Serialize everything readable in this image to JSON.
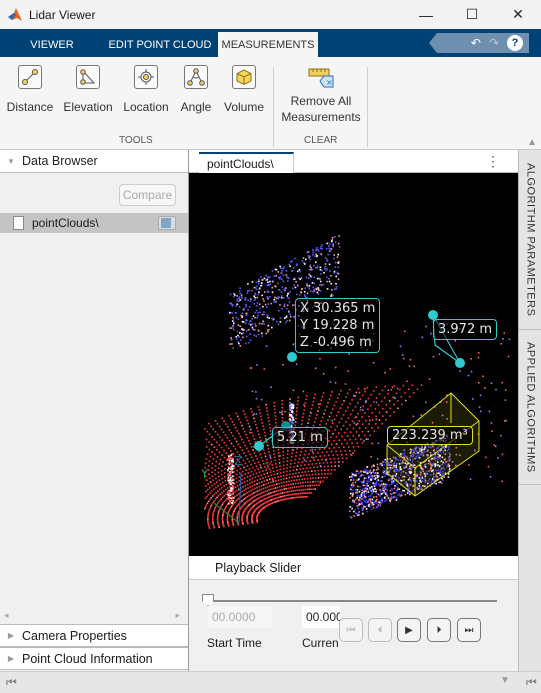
{
  "window": {
    "title": "Lidar Viewer",
    "minimize": "—",
    "maximize": "☐",
    "close": "✕"
  },
  "tabs": [
    {
      "label": "VIEWER",
      "active": false
    },
    {
      "label": "EDIT POINT CLOUD",
      "active": false
    },
    {
      "label": "MEASUREMENTS",
      "active": true
    }
  ],
  "quick_access": {
    "undo": "↶",
    "redo": "↷",
    "help": "?"
  },
  "ribbon": {
    "tools": [
      {
        "label": "Distance",
        "icon": "distance-icon"
      },
      {
        "label": "Elevation",
        "icon": "elevation-icon"
      },
      {
        "label": "Location",
        "icon": "location-icon"
      },
      {
        "label": "Angle",
        "icon": "angle-icon"
      },
      {
        "label": "Volume",
        "icon": "volume-icon"
      }
    ],
    "tools_group": "TOOLS",
    "remove_all": {
      "line1": "Remove All",
      "line2": "Measurements"
    },
    "clear_group": "CLEAR"
  },
  "data_browser": {
    "title": "Data Browser",
    "compare_label": "Compare",
    "items": [
      {
        "name": "pointClouds\\",
        "color": "#7fa7c9"
      }
    ]
  },
  "bottom_sections": [
    "Camera Properties",
    "Point Cloud Information"
  ],
  "document": {
    "tab_label": "pointClouds\\",
    "menu": "⋮"
  },
  "right_rail": [
    "ALGORITHM PARAMETERS",
    "APPLIED ALGORITHMS"
  ],
  "measurements": {
    "location": {
      "x": "X 30.365 m",
      "y": "Y 19.228 m",
      "z": "Z -0.496 m"
    },
    "distance_1": "3.972 m",
    "distance_2": "5.21 m",
    "volume": "223.239 m³",
    "colors": {
      "callout": "#2fc9cf",
      "volume": "#e6e21a"
    }
  },
  "axes": {
    "x": "X",
    "y": "Y",
    "z": "Z"
  },
  "playback": {
    "title": "Playback Slider",
    "start_value": "00.0000",
    "current_value": "00.000",
    "start_label": "Start Time",
    "current_label": "Curren",
    "position": 0
  }
}
